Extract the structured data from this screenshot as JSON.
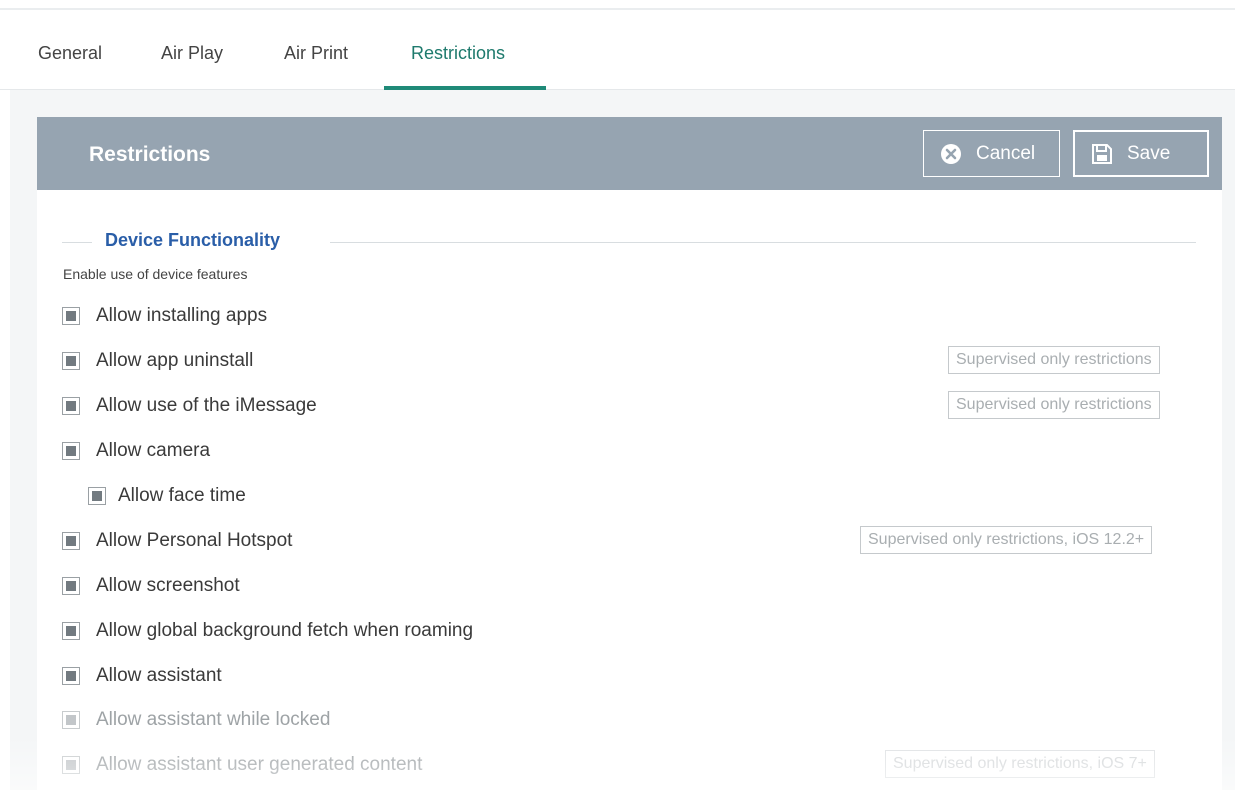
{
  "tabs": [
    {
      "label": "General"
    },
    {
      "label": "Air Play"
    },
    {
      "label": "Air Print"
    },
    {
      "label": "Restrictions",
      "active": true
    }
  ],
  "panel": {
    "title": "Restrictions",
    "cancel_label": "Cancel",
    "save_label": "Save"
  },
  "section": {
    "title": "Device Functionality",
    "subtitle": "Enable use of device features"
  },
  "options": [
    {
      "label": "Allow installing apps",
      "checked": true
    },
    {
      "label": "Allow app uninstall",
      "checked": true,
      "badge": "Supervised only restrictions"
    },
    {
      "label": "Allow use of the iMessage",
      "checked": true,
      "badge": "Supervised only restrictions"
    },
    {
      "label": "Allow camera",
      "checked": true
    },
    {
      "label": "Allow face time",
      "checked": true,
      "indented": true
    },
    {
      "label": "Allow Personal Hotspot",
      "checked": true,
      "badge": "Supervised only restrictions, iOS 12.2+"
    },
    {
      "label": "Allow screenshot",
      "checked": true
    },
    {
      "label": "Allow global background fetch when roaming",
      "checked": true
    },
    {
      "label": "Allow assistant",
      "checked": true
    },
    {
      "label": "Allow assistant while locked",
      "checked": true,
      "disabled": true
    },
    {
      "label": "Allow assistant user generated content",
      "checked": true,
      "disabled": true,
      "badge": "Supervised only restrictions, iOS 7+"
    }
  ],
  "colors": {
    "accent": "#1f8a78",
    "header_bg": "#96a4b1",
    "section_title": "#2a5ea8"
  },
  "icons": {
    "cancel": "close-circle-icon",
    "save": "floppy-disk-icon"
  }
}
